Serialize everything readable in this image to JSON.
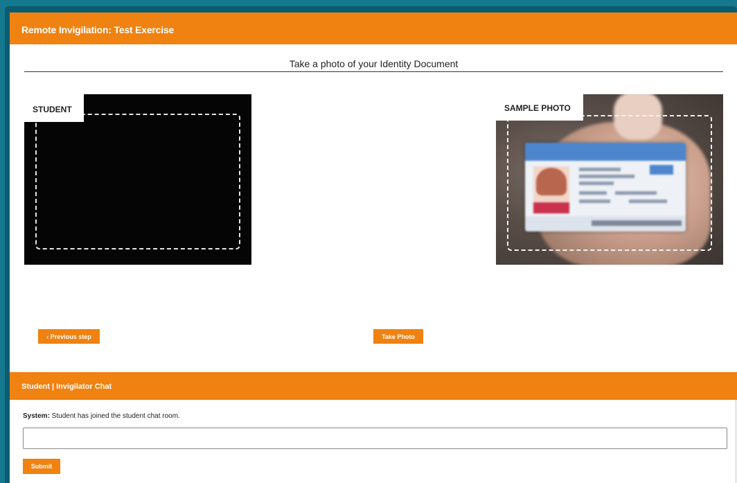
{
  "window": {
    "title": "Remote Invigilation: Test Exercise"
  },
  "step": {
    "heading": "Take a photo of your Identity Document"
  },
  "camera": {
    "label": "STUDENT"
  },
  "sample": {
    "label": "SAMPLE PHOTO"
  },
  "actions": {
    "previous_label": "‹ Previous step",
    "take_photo_label": "Take Photo"
  },
  "chat": {
    "title": "Student | Invigilator Chat",
    "messages": [
      {
        "sender": "System:",
        "text": " Student has joined the student chat room."
      }
    ],
    "input_value": "",
    "submit_label": "Submit"
  },
  "colors": {
    "accent": "#ef8211",
    "frame": "#0b5c70",
    "background": "#14788f"
  }
}
